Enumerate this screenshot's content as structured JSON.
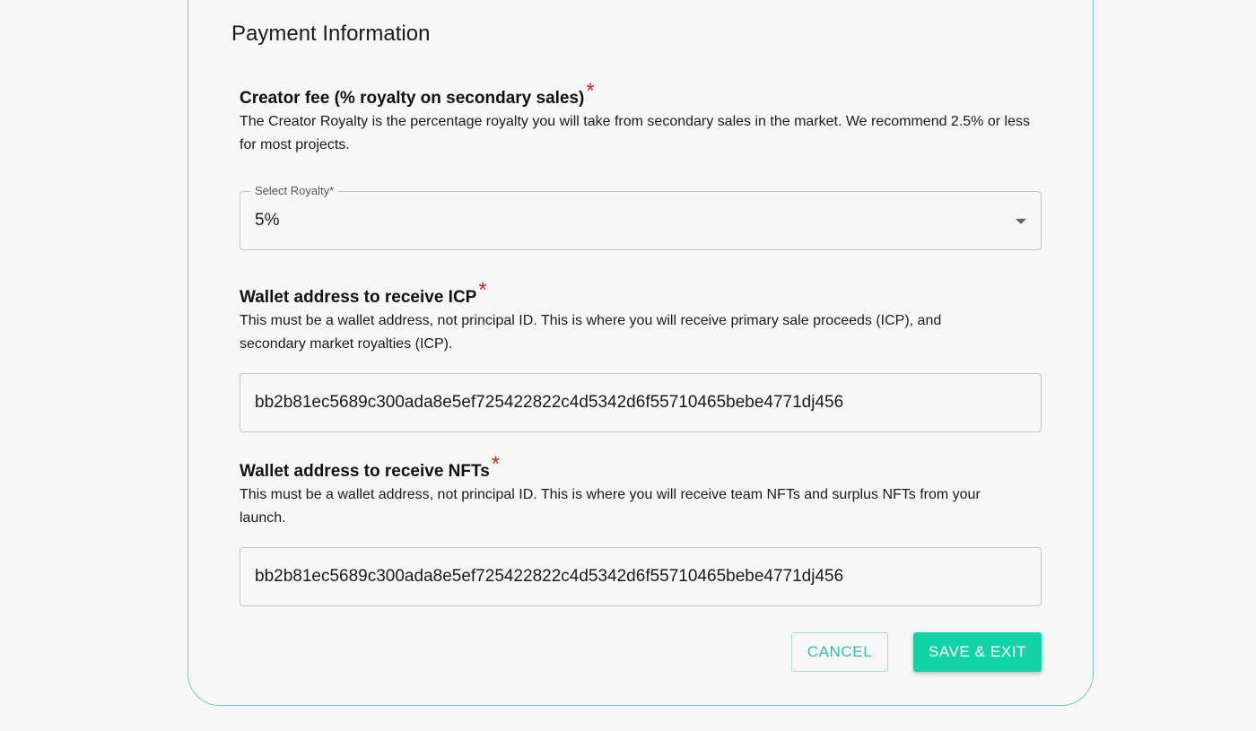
{
  "section": {
    "title": "Payment Information"
  },
  "royalty": {
    "heading": "Creator fee (% royalty on secondary sales)",
    "required_mark": "*",
    "description": "The Creator Royalty is the percentage royalty you will take from secondary sales in the market. We recommend 2.5% or less for most projects.",
    "select_label": "Select Royalty",
    "select_required": "*",
    "selected_value": "5%"
  },
  "icp_wallet": {
    "heading": "Wallet address to receive ICP",
    "required_mark": "*",
    "description": "This must be a wallet address, not principal ID. This is where you will receive primary sale proceeds (ICP), and secondary market royalties (ICP).",
    "value": "bb2b81ec5689c300ada8e5ef725422822c4d5342d6f55710465bebe4771dj456"
  },
  "nft_wallet": {
    "heading": "Wallet address to receive NFTs",
    "required_mark": "*",
    "description": "This must be a wallet address, not principal ID. This is where you will receive team NFTs and surplus NFTs from your launch.",
    "value": "bb2b81ec5689c300ada8e5ef725422822c4d5342d6f55710465bebe4771dj456"
  },
  "actions": {
    "cancel_label": "CANCEL",
    "save_label": "SAVE & EXIT"
  },
  "colors": {
    "accent": "#13d2a8",
    "card_border": "#7cc8bd",
    "required": "#c62828"
  },
  "icons": {
    "select_caret": "chevron-down-icon"
  }
}
